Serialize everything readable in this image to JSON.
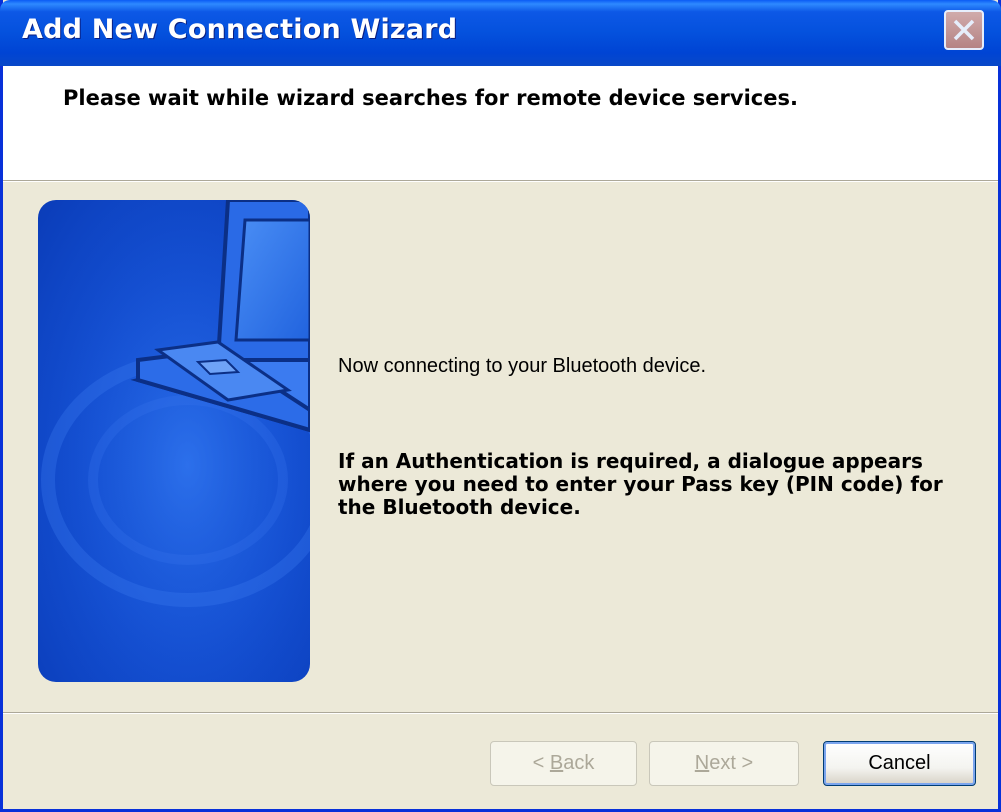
{
  "window": {
    "title": "Add New Connection Wizard"
  },
  "header": {
    "heading": "Please wait while wizard searches for remote device services."
  },
  "content": {
    "status": "Now connecting to your Bluetooth device.",
    "auth_notice": "If an Authentication is required, a dialogue appears where you need to enter your Pass key (PIN code) for the Bluetooth device."
  },
  "buttons": {
    "back": {
      "prefix": "< ",
      "mnemonic": "B",
      "rest": "ack",
      "enabled": false
    },
    "next": {
      "mnemonic": "N",
      "rest": "ext",
      "suffix": " >",
      "enabled": false
    },
    "cancel": {
      "label": "Cancel",
      "enabled": true
    }
  },
  "icons": {
    "close": "close-icon",
    "artwork": "laptop-illustration"
  },
  "colors": {
    "titlebar": "#0451DD",
    "dialog_bg": "#ECE9D8",
    "artwork_blue": "#1552D6"
  }
}
